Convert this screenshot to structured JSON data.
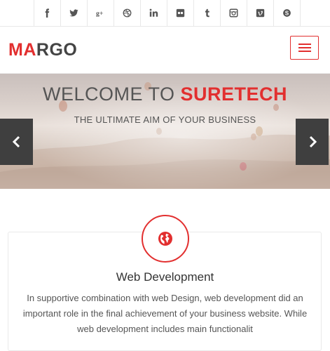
{
  "social": {
    "items": [
      {
        "name": "facebook",
        "glyph": "f"
      },
      {
        "name": "twitter",
        "glyph": "t"
      },
      {
        "name": "google-plus",
        "glyph": "g+"
      },
      {
        "name": "dribbble",
        "glyph": "dribbble"
      },
      {
        "name": "linkedin",
        "glyph": "in"
      },
      {
        "name": "flickr",
        "glyph": "flickr"
      },
      {
        "name": "tumblr",
        "glyph": "t"
      },
      {
        "name": "instagram",
        "glyph": "instagram"
      },
      {
        "name": "vimeo",
        "glyph": "v"
      },
      {
        "name": "skype",
        "glyph": "s"
      }
    ]
  },
  "header": {
    "logo_accent": "MA",
    "logo_rest": "RGO",
    "menu_icon": "hamburger-icon"
  },
  "hero": {
    "title_prefix": "WELCOME TO ",
    "title_accent": "SURETECH",
    "subtitle": "THE ULTIMATE AIM OF YOUR BUSINESS",
    "prev_icon": "chevron-left-icon",
    "next_icon": "chevron-right-icon"
  },
  "service": {
    "icon": "globe-icon",
    "title": "Web Development",
    "text": "In supportive combination with web Design, web development did an important role in the final achievement of your business website. While web development includes main functionalit"
  },
  "colors": {
    "accent": "#e22f2f",
    "arrow_bg": "#3f3f3f"
  }
}
